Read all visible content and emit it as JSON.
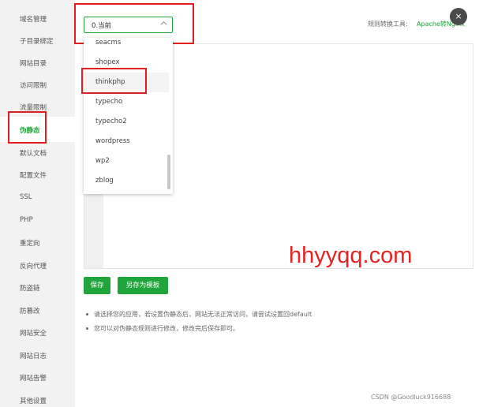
{
  "sidebar": {
    "items": [
      {
        "label": "域名管理"
      },
      {
        "label": "子目录绑定"
      },
      {
        "label": "网站目录"
      },
      {
        "label": "访问限制"
      },
      {
        "label": "流量限制"
      },
      {
        "label": "伪静态",
        "active": true
      },
      {
        "label": "默认文档"
      },
      {
        "label": "配置文件"
      },
      {
        "label": "SSL"
      },
      {
        "label": "PHP"
      },
      {
        "label": "重定向"
      },
      {
        "label": "反向代理"
      },
      {
        "label": "防盗链"
      },
      {
        "label": "防篡改"
      },
      {
        "label": "网站安全"
      },
      {
        "label": "网站日志"
      },
      {
        "label": "网站告警"
      },
      {
        "label": "其他设置"
      }
    ]
  },
  "rewrite_select": {
    "value": "0.当前",
    "options": [
      "seacms",
      "shopex",
      "thinkphp",
      "typecho",
      "typecho2",
      "wordpress",
      "wp2",
      "zblog"
    ],
    "highlighted": "thinkphp"
  },
  "rule_tool": {
    "label": "规则转换工具:",
    "link": "Apache转Nginx"
  },
  "close_icon": "×",
  "chevron_icon": "∨",
  "buttons": {
    "save": "保存",
    "save_as_template": "另存为模板"
  },
  "tips": [
    "请选择您的应用，若设置伪静态后，网站无法正常访问，请尝试设置回default",
    "您可以对伪静态规则进行修改，修改完后保存即可。"
  ],
  "watermark": "hhyyqq.com",
  "credit": "CSDN @Goodluck916688",
  "colors": {
    "accent": "#20a53a",
    "annotation_red": "#e02020"
  }
}
